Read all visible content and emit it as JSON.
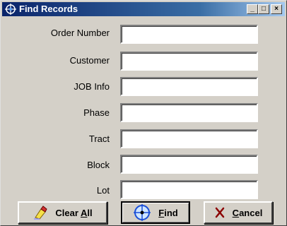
{
  "window": {
    "title": "Find Records",
    "minimize_glyph": "_",
    "maximize_glyph": "□",
    "close_glyph": "×"
  },
  "fields": [
    {
      "label": "Order Number",
      "value": ""
    },
    {
      "label": "Customer",
      "value": ""
    },
    {
      "label": "JOB Info",
      "value": ""
    },
    {
      "label": "Phase",
      "value": ""
    },
    {
      "label": "Tract",
      "value": ""
    },
    {
      "label": "Block",
      "value": ""
    },
    {
      "label": "Lot",
      "value": ""
    }
  ],
  "buttons": {
    "clear_all": {
      "label_pre": "Clear ",
      "label_accel": "A",
      "label_post": "ll",
      "icon": "eraser-icon"
    },
    "find": {
      "label_pre": "",
      "label_accel": "F",
      "label_post": "ind",
      "icon": "crosshair-icon"
    },
    "cancel": {
      "label_pre": "",
      "label_accel": "C",
      "label_post": "ancel",
      "icon": "x-icon"
    }
  },
  "colors": {
    "titlebar_start": "#0a246a",
    "titlebar_end": "#a6caf0",
    "face": "#d4d0c8",
    "cancel_x": "#8b0000"
  }
}
